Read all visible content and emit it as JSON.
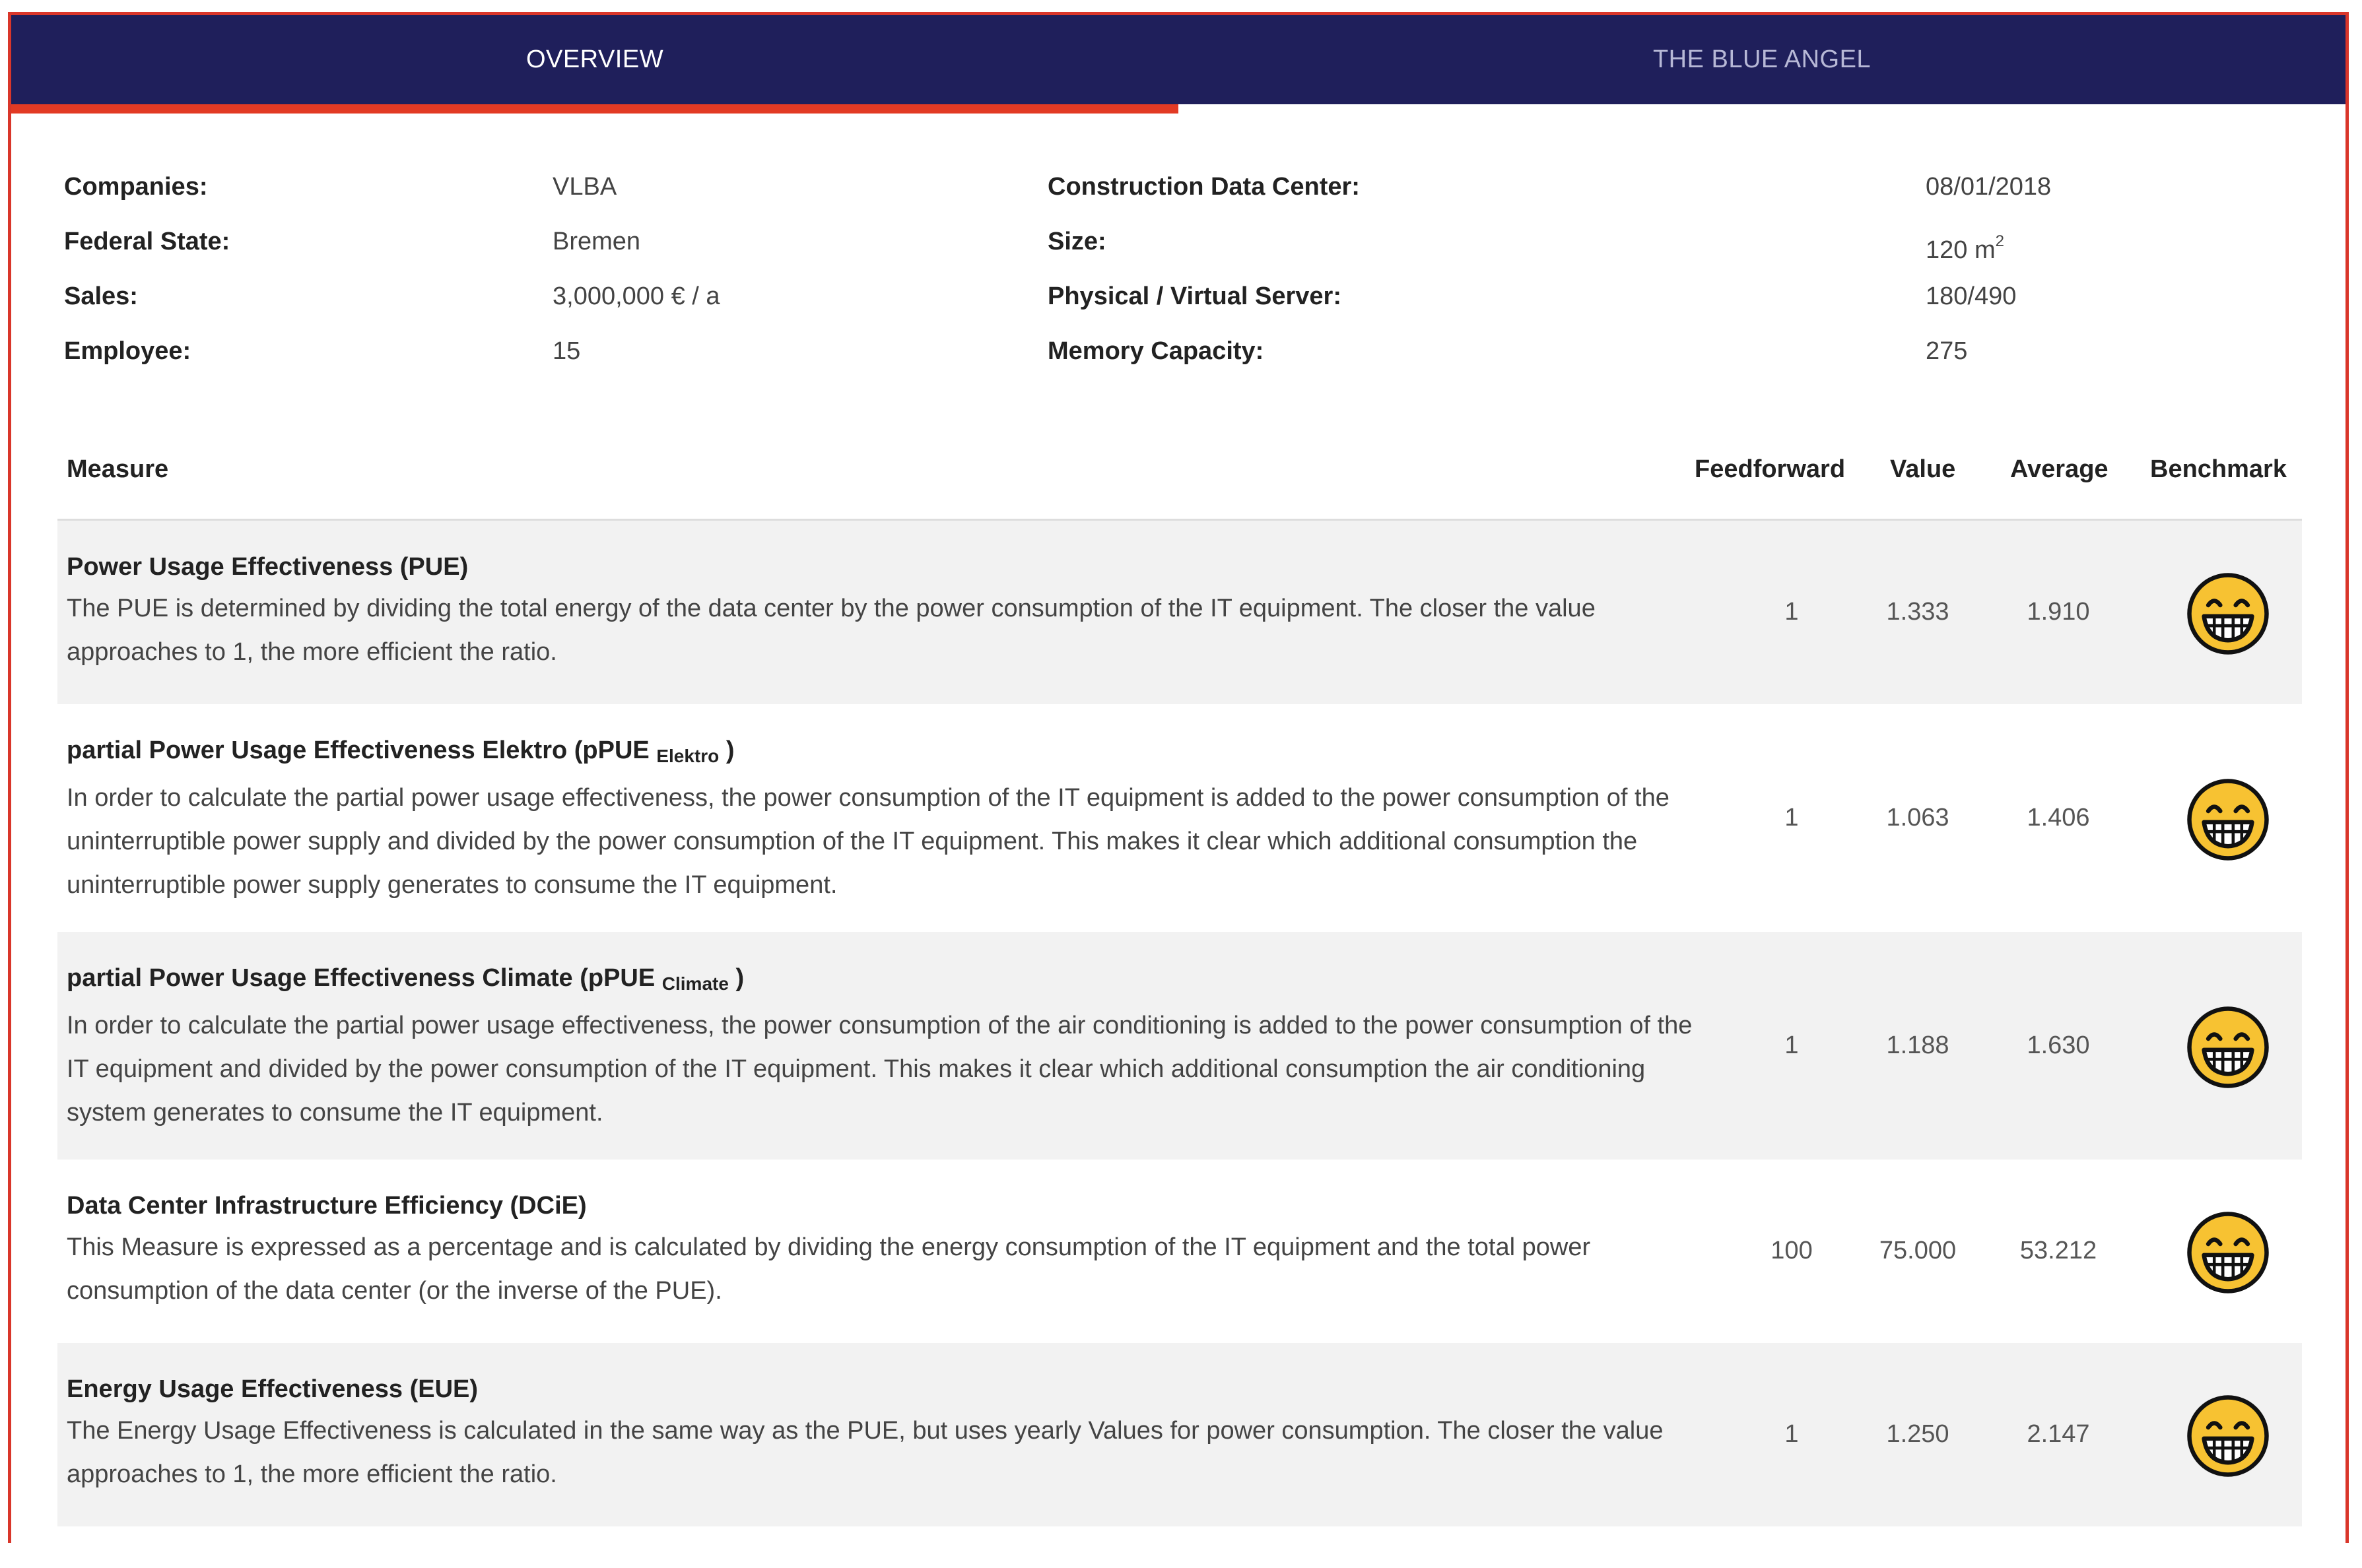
{
  "tabs": [
    {
      "label": "OVERVIEW",
      "active": true
    },
    {
      "label": "THE BLUE ANGEL",
      "active": false
    }
  ],
  "info": {
    "companies_label": "Companies:",
    "companies_value": "VLBA",
    "federal_state_label": "Federal State:",
    "federal_state_value": "Bremen",
    "sales_label": "Sales:",
    "sales_value": "3,000,000 € / a",
    "employee_label": "Employee:",
    "employee_value": "15",
    "construction_label": "Construction Data Center:",
    "construction_value": "08/01/2018",
    "size_label": "Size:",
    "size_value": "120 m",
    "size_exponent": "2",
    "server_label": "Physical / Virtual Server:",
    "server_value": "180/490",
    "memory_label": "Memory Capacity:",
    "memory_value": "275"
  },
  "table": {
    "headers": {
      "measure": "Measure",
      "feedforward": "Feedforward",
      "value": "Value",
      "average": "Average",
      "benchmark": "Benchmark"
    },
    "rows": [
      {
        "title": "Power Usage Effectiveness (PUE)",
        "title_sub": "",
        "title_end": "",
        "description": "The PUE is determined by dividing the total energy of the data center by the power consumption of the IT equipment. The closer the value approaches to 1, the more efficient the ratio.",
        "feedforward": "1",
        "value": "1.333",
        "average": "1.910",
        "benchmark_icon": "grinning-face-icon"
      },
      {
        "title": "partial Power Usage Effectiveness Elektro (pPUE",
        "title_sub": "Elektro",
        "title_end": ")",
        "description": "In order to calculate the partial power usage effectiveness, the power consumption of the IT equipment is added to the power consumption of the uninterruptible power supply and divided by the power consumption of the IT equipment. This makes it clear which additional consumption the uninterruptible power supply generates to consume the IT equipment.",
        "feedforward": "1",
        "value": "1.063",
        "average": "1.406",
        "benchmark_icon": "grinning-face-icon"
      },
      {
        "title": "partial Power Usage Effectiveness Climate (pPUE",
        "title_sub": "Climate",
        "title_end": ")",
        "description": "In order to calculate the partial power usage effectiveness, the power consumption of the air conditioning is added to the power consumption of the IT equipment and divided by the power consumption of the IT equipment. This makes it clear which additional consumption the air conditioning system generates to consume the IT equipment.",
        "feedforward": "1",
        "value": "1.188",
        "average": "1.630",
        "benchmark_icon": "grinning-face-icon"
      },
      {
        "title": "Data Center Infrastructure Efficiency (DCiE)",
        "title_sub": "",
        "title_end": "",
        "description": "This Measure is expressed as a percentage and is calculated by dividing the energy consumption of the IT equipment and the total power consumption of the data center (or the inverse of the PUE).",
        "feedforward": "100",
        "value": "75.000",
        "average": "53.212",
        "benchmark_icon": "grinning-face-icon"
      },
      {
        "title": "Energy Usage Effectiveness (EUE)",
        "title_sub": "",
        "title_end": "",
        "description": "The Energy Usage Effectiveness is calculated in the same way as the PUE, but uses yearly Values for power consumption. The closer the value approaches to 1, the more efficient the ratio.",
        "feedforward": "1",
        "value": "1.250",
        "average": "2.147",
        "benchmark_icon": "grinning-face-icon"
      }
    ]
  },
  "colors": {
    "tabbar": "#1f1f5b",
    "accent": "#e23a24",
    "smiley_fill": "#f7c232"
  }
}
